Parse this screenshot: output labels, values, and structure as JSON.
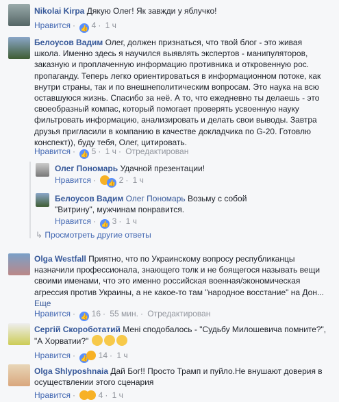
{
  "comments": [
    {
      "author": "Nikolai Kirpa",
      "text": "Дякую Олег! Як завжди у яблучко!",
      "like": "Нравится",
      "count": "4",
      "time": "1 ч"
    },
    {
      "author": "Белоусов Вадим",
      "text": "Олег, должен признаться, что твой блог - это живая школа. Именно здесь я научился выявлять экспертов - манипуляторов, заказную и проплаченную информацию противника и откровенную рос. пропаганду. Теперь легко ориентироваться в информационном потоке, как внутри страны, так и по внешнеполитическим вопросам. Это наука на всю оставшуюся жизнь. Спасибо за неё. А то, что ежедневно ты делаешь - это своеобразный компас, который помогает проверять усвоенную науку фильтровать информацию, анализировать и делать свои выводы. Завтра друзья пригласили в компанию в качестве докладчика по G-20. Готовлю конспект)), буду тебя, Олег, цитировать.",
      "like": "Нравится",
      "count": "5",
      "time": "1 ч",
      "edited": "Отредактирован"
    },
    {
      "author": "Олег Пономарь",
      "text": "Удачной презентации!",
      "like": "Нравится",
      "count": "2",
      "time": "1 ч"
    },
    {
      "author": "Белоусов Вадим",
      "mention": "Олег Пономарь",
      "text": "Возьму с собой \"Витрину\", мужчинам понравится.",
      "like": "Нравится",
      "count": "3",
      "time": "1 ч"
    },
    {
      "author": "Olga Westfall",
      "text": "Приятно, что по Украинскому вопросу республиканцы назначили профессионала, знающего толк и не боящегося называть вещи своими именами, что это именно российская военная/экономическая агрессия против Украины, а не какое-то там \"народное восстание\" на Дон...",
      "see_more": "Еще",
      "like": "Нравится",
      "count": "16",
      "time": "55 мин.",
      "edited": "Отредактирован"
    },
    {
      "author": "Сергій Скороботатий",
      "text": "Мені сподобалось - \"Судьбу Милошевича помните?\", \"А Хорватии?\"",
      "like": "Нравится",
      "count": "14",
      "time": "1 ч"
    },
    {
      "author": "Olga Shlyposhnaia",
      "text": "Дай Бог!! Просто Трамп и пуйло.Не внушают доверия в осуществлении этого сценария",
      "like": "Нравится",
      "count": "4",
      "time": "1 ч"
    }
  ],
  "more_replies": "Просмотреть другие ответы",
  "icons": [
    "like-icon",
    "haha-icon",
    "wow-icon",
    "reply-icon"
  ]
}
